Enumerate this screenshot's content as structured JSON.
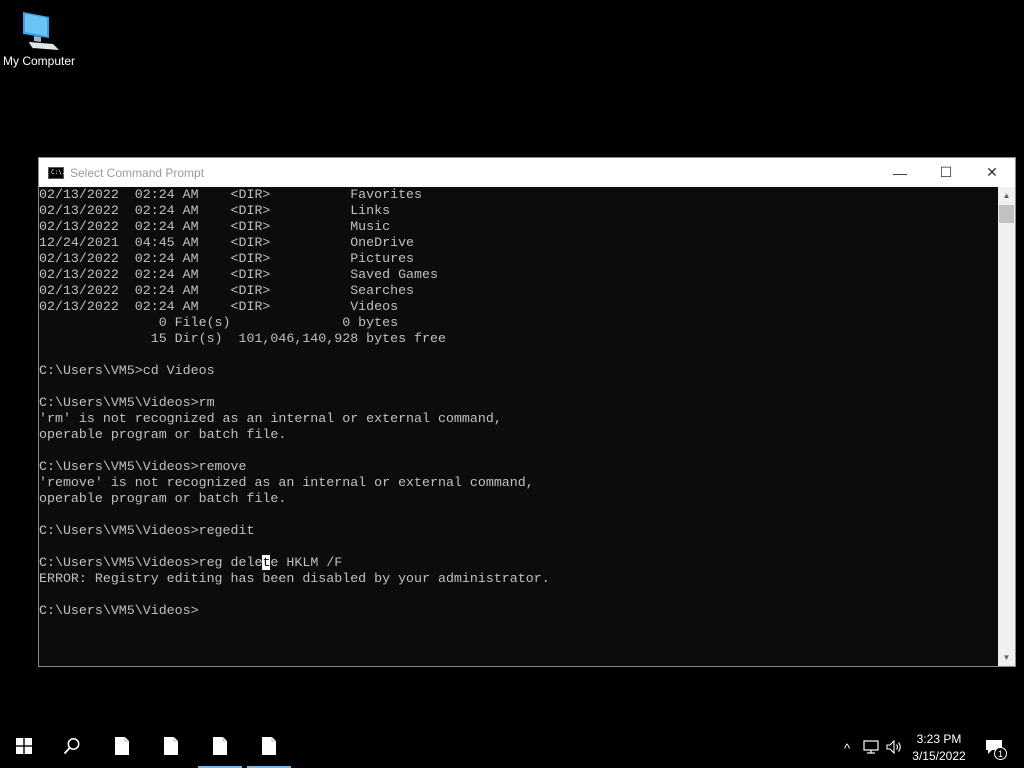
{
  "desktop": {
    "icons": [
      {
        "label": "My Computer",
        "icon": "computer-icon"
      }
    ]
  },
  "window": {
    "title": "Select Command Prompt",
    "icon": "cmd-icon",
    "app_icon_text": "C:\\.",
    "controls": {
      "minimize": "—",
      "maximize": "☐",
      "close": "✕"
    }
  },
  "console": {
    "lines": [
      "02/13/2022  02:24 AM    <DIR>          Favorites",
      "02/13/2022  02:24 AM    <DIR>          Links",
      "02/13/2022  02:24 AM    <DIR>          Music",
      "12/24/2021  04:45 AM    <DIR>          OneDrive",
      "02/13/2022  02:24 AM    <DIR>          Pictures",
      "02/13/2022  02:24 AM    <DIR>          Saved Games",
      "02/13/2022  02:24 AM    <DIR>          Searches",
      "02/13/2022  02:24 AM    <DIR>          Videos",
      "               0 File(s)              0 bytes",
      "              15 Dir(s)  101,046,140,928 bytes free",
      "",
      "C:\\Users\\VM5>cd Videos",
      "",
      "C:\\Users\\VM5\\Videos>rm",
      "'rm' is not recognized as an internal or external command,",
      "operable program or batch file.",
      "",
      "C:\\Users\\VM5\\Videos>remove",
      "'remove' is not recognized as an internal or external command,",
      "operable program or batch file.",
      "",
      "C:\\Users\\VM5\\Videos>regedit",
      "",
      "C:\\Users\\VM5\\Videos>reg delete HKLM /F",
      "ERROR: Registry editing has been disabled by your administrator.",
      "",
      "C:\\Users\\VM5\\Videos>"
    ],
    "selection": {
      "line": 23,
      "char": 28
    }
  },
  "taskbar": {
    "start_icon": "windows-start-icon",
    "search_icon": "search-icon",
    "pinned": [
      {
        "name": "document-icon",
        "active": false
      },
      {
        "name": "document-icon",
        "active": false
      },
      {
        "name": "document-icon",
        "active": true
      },
      {
        "name": "document-icon",
        "active": true
      }
    ],
    "tray": {
      "chevron": "^",
      "network_icon": "network-icon",
      "volume_icon": "volume-icon",
      "time": "3:23 PM",
      "date": "3/15/2022",
      "notification_icon": "notification-icon",
      "notification_count": "1"
    }
  },
  "colors": {
    "console_bg": "#0c0c0c",
    "console_fg": "#c0c0c0",
    "accent": "#76b9ed"
  }
}
